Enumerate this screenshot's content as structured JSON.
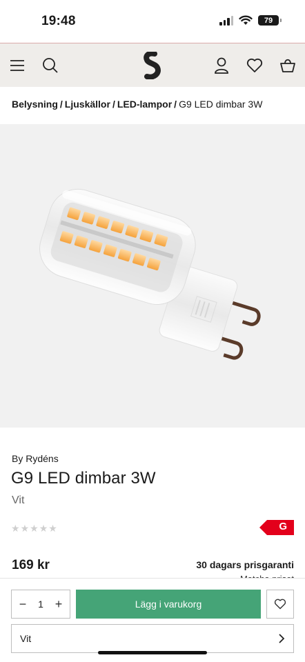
{
  "status_bar": {
    "time": "19:48",
    "battery": "79"
  },
  "header": {
    "icons": [
      "menu-icon",
      "search-icon",
      "brand-logo",
      "account-icon",
      "heart-icon",
      "basket-icon"
    ]
  },
  "breadcrumb": {
    "items": [
      "Belysning",
      "Ljuskällor",
      "LED-lampor"
    ],
    "separator": "/",
    "current": "G9 LED dimbar 3W"
  },
  "product": {
    "brand": "By Rydéns",
    "title": "G9 LED dimbar 3W",
    "variant": "Vit",
    "rating_stars": 0,
    "rating_max": 5,
    "energy_class": "G",
    "energy_color": "#e3001b",
    "price": "169 kr",
    "guarantee": "30 dagars prisgaranti",
    "guarantee_more": "Matcha priset"
  },
  "buy_bar": {
    "quantity": "1",
    "add_to_cart": "Lägg i varukorg",
    "add_color": "#45a477",
    "color_option": "Vit"
  }
}
